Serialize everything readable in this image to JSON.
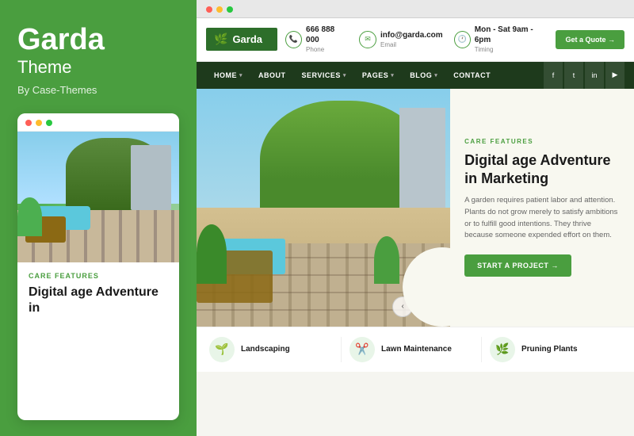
{
  "sidebar": {
    "logo_title": "Garda",
    "logo_subtitle": "Theme",
    "by_label": "By Case-Themes",
    "dots": [
      "red",
      "yellow",
      "green"
    ],
    "card": {
      "tag": "CARE FEATURES",
      "title": "Digital age Adventure in"
    }
  },
  "browser": {
    "dots": [
      "red",
      "yellow",
      "green"
    ]
  },
  "website": {
    "header": {
      "logo_icon": "🌿",
      "logo_text": "Garda",
      "phone_icon": "📞",
      "phone_number": "666 888 000",
      "phone_label": "Phone",
      "email_icon": "✉",
      "email_address": "info@garda.com",
      "email_label": "Email",
      "clock_icon": "🕐",
      "timing_text": "Mon - Sat 9am - 6pm",
      "timing_label": "Timing",
      "quote_button": "Get a Quote →"
    },
    "nav": {
      "items": [
        {
          "label": "HOME",
          "has_dropdown": true
        },
        {
          "label": "ABOUT",
          "has_dropdown": false
        },
        {
          "label": "SERVICES",
          "has_dropdown": true
        },
        {
          "label": "PAGES",
          "has_dropdown": true
        },
        {
          "label": "BLOG",
          "has_dropdown": true
        },
        {
          "label": "CONTACT",
          "has_dropdown": false
        }
      ],
      "social": [
        "f",
        "t",
        "in",
        "▶"
      ]
    },
    "hero": {
      "tag": "CARE FEATURES",
      "title": "Digital age Adventure in Marketing",
      "description": "A garden requires patient labor and attention. Plants do not grow merely to satisfy ambitions or to fulfill good intentions. They thrive because someone expended effort on them.",
      "cta_label": "START A PROJECT →"
    },
    "services": [
      {
        "icon": "🌱",
        "label": "Landscaping"
      },
      {
        "icon": "✂️",
        "label": "Lawn Maintenance"
      },
      {
        "icon": "🌿",
        "label": "Pruning Plants"
      }
    ]
  }
}
